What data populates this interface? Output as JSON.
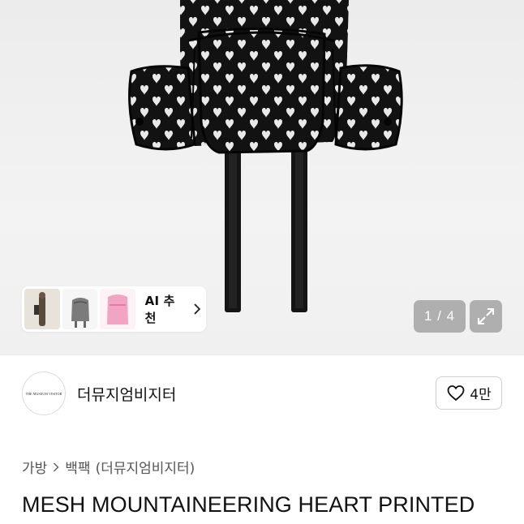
{
  "ai_strip": {
    "label": "AI 추천"
  },
  "pager": {
    "current": 1,
    "total": 4,
    "text": "1 / 4"
  },
  "seller": {
    "logo_text": "THE MUSEUM VISITOR",
    "name": "더뮤지엄비지터"
  },
  "like": {
    "count": "4만"
  },
  "breadcrumb": {
    "level1": "가방",
    "level2": "백팩",
    "brand": "(더뮤지엄비지터)"
  },
  "product": {
    "title": "MESH MOUNTAINEERING HEART PRINTED"
  },
  "icons": {
    "expand": "expand-arrows-icon",
    "like": "heart-outline-icon",
    "chevron": "chevron-right-icon"
  },
  "colors": {
    "bag": "#111111",
    "heart": "#e9e9e9",
    "hero_bg": "#eeeeee",
    "pager_bg": "#888888"
  }
}
